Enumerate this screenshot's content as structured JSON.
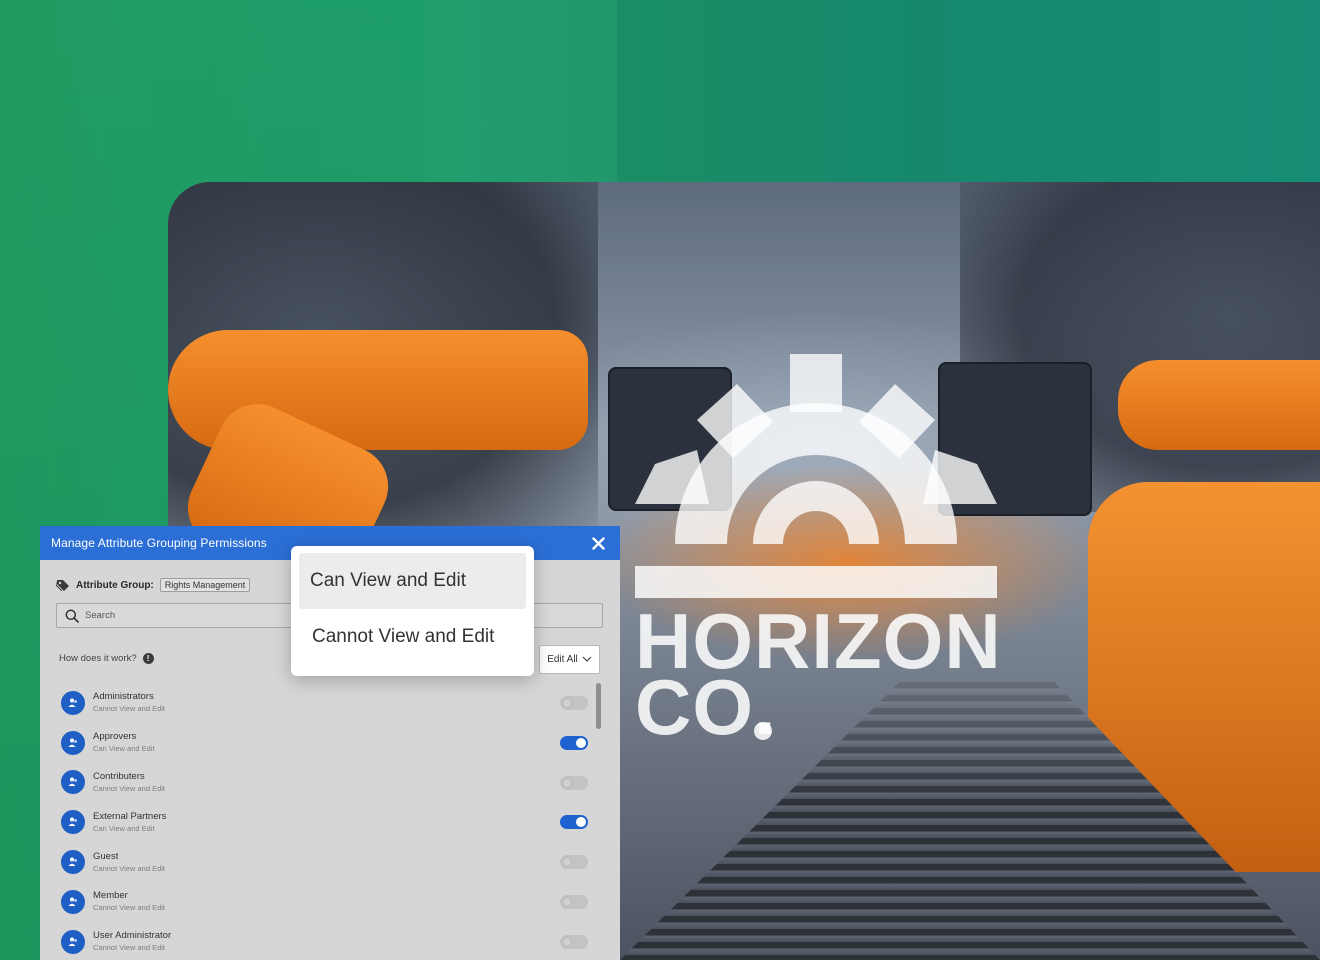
{
  "brand": {
    "logo_line1": "HORIZON",
    "logo_line2": "CO.",
    "logo_color": "#ffffff"
  },
  "modal": {
    "title": "Manage Attribute Grouping Permissions",
    "close_icon": "close-icon",
    "attribute_group_label": "Attribute Group:",
    "attribute_group_value": "Rights Management",
    "search_placeholder": "Search",
    "help_text": "How does it work?",
    "edit_all_label": "Edit All",
    "accent_color": "#2b6fd6",
    "roles": [
      {
        "name": "Administrators",
        "status": "Cannot View and Edit",
        "enabled": false
      },
      {
        "name": "Approvers",
        "status": "Can View and Edit",
        "enabled": true
      },
      {
        "name": "Contributers",
        "status": "Cannot View and Edit",
        "enabled": false
      },
      {
        "name": "External Partners",
        "status": "Can View and Edit",
        "enabled": true
      },
      {
        "name": "Guest",
        "status": "Cannot View and Edit",
        "enabled": false
      },
      {
        "name": "Member",
        "status": "Cannot View and Edit",
        "enabled": false
      },
      {
        "name": "User Administrator",
        "status": "Cannot View and Edit",
        "enabled": false
      }
    ]
  },
  "dropdown": {
    "options": [
      "Can View and Edit",
      "Cannot View and Edit"
    ],
    "selected": "Can View and Edit"
  }
}
